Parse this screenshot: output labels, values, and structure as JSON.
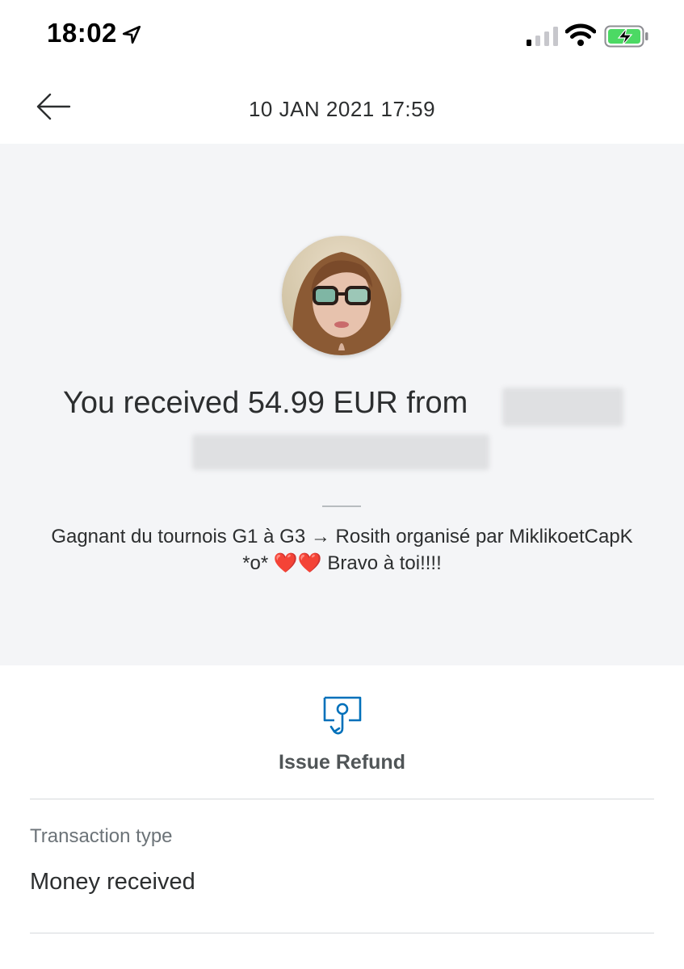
{
  "status_bar": {
    "time": "18:02",
    "location_icon": "location-arrow-icon",
    "signal_icon": "cellular-signal-icon",
    "wifi_icon": "wifi-icon",
    "battery_icon": "battery-charging-icon",
    "battery_color": "#4cd964"
  },
  "nav": {
    "back_icon": "back-arrow-icon",
    "date": "10 JAN 2021  17:59"
  },
  "transaction": {
    "headline": "You received 54.99 EUR from",
    "note_text": "Gagnant du tournois G1 à G3 → Rosith organisé par MiklikoetCapK *o* ",
    "note_hearts": "❤️❤️",
    "note_end": " Bravo à toi!!!!"
  },
  "actions": {
    "refund_icon": "refund-icon",
    "refund_label": "Issue Refund",
    "accent_color": "#0070ba"
  },
  "details": {
    "transaction_type_label": "Transaction type",
    "transaction_type_value": "Money received"
  }
}
